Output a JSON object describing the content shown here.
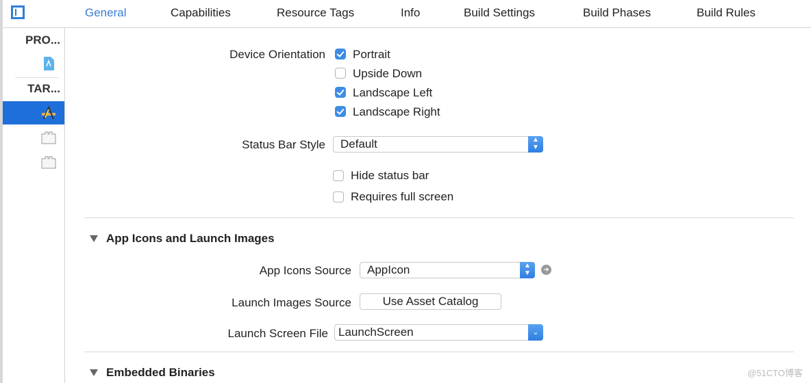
{
  "tabs": [
    {
      "label": "General",
      "active": true
    },
    {
      "label": "Capabilities"
    },
    {
      "label": "Resource Tags"
    },
    {
      "label": "Info"
    },
    {
      "label": "Build Settings"
    },
    {
      "label": "Build Phases"
    },
    {
      "label": "Build Rules"
    }
  ],
  "sidebar": {
    "project_header": "PRO...",
    "targets_header": "TAR..."
  },
  "deployment": {
    "device_orientation_label": "Device Orientation",
    "orientations": [
      {
        "label": "Portrait",
        "checked": true
      },
      {
        "label": "Upside Down",
        "checked": false
      },
      {
        "label": "Landscape Left",
        "checked": true
      },
      {
        "label": "Landscape Right",
        "checked": true
      }
    ],
    "status_bar_style_label": "Status Bar Style",
    "status_bar_style_value": "Default",
    "hide_status_bar": {
      "label": "Hide status bar",
      "checked": false
    },
    "requires_full_screen": {
      "label": "Requires full screen",
      "checked": false
    }
  },
  "app_icons": {
    "section_title": "App Icons and Launch Images",
    "app_icons_source_label": "App Icons Source",
    "app_icons_source_value": "AppIcon",
    "launch_images_source_label": "Launch Images Source",
    "launch_images_button": "Use Asset Catalog",
    "launch_screen_file_label": "Launch Screen File",
    "launch_screen_file_value": "LaunchScreen"
  },
  "embedded": {
    "section_title": "Embedded Binaries"
  },
  "watermark": "@51CTO博客",
  "colors": {
    "accent": "#3b7ed0",
    "selection": "#1e6fd9"
  }
}
